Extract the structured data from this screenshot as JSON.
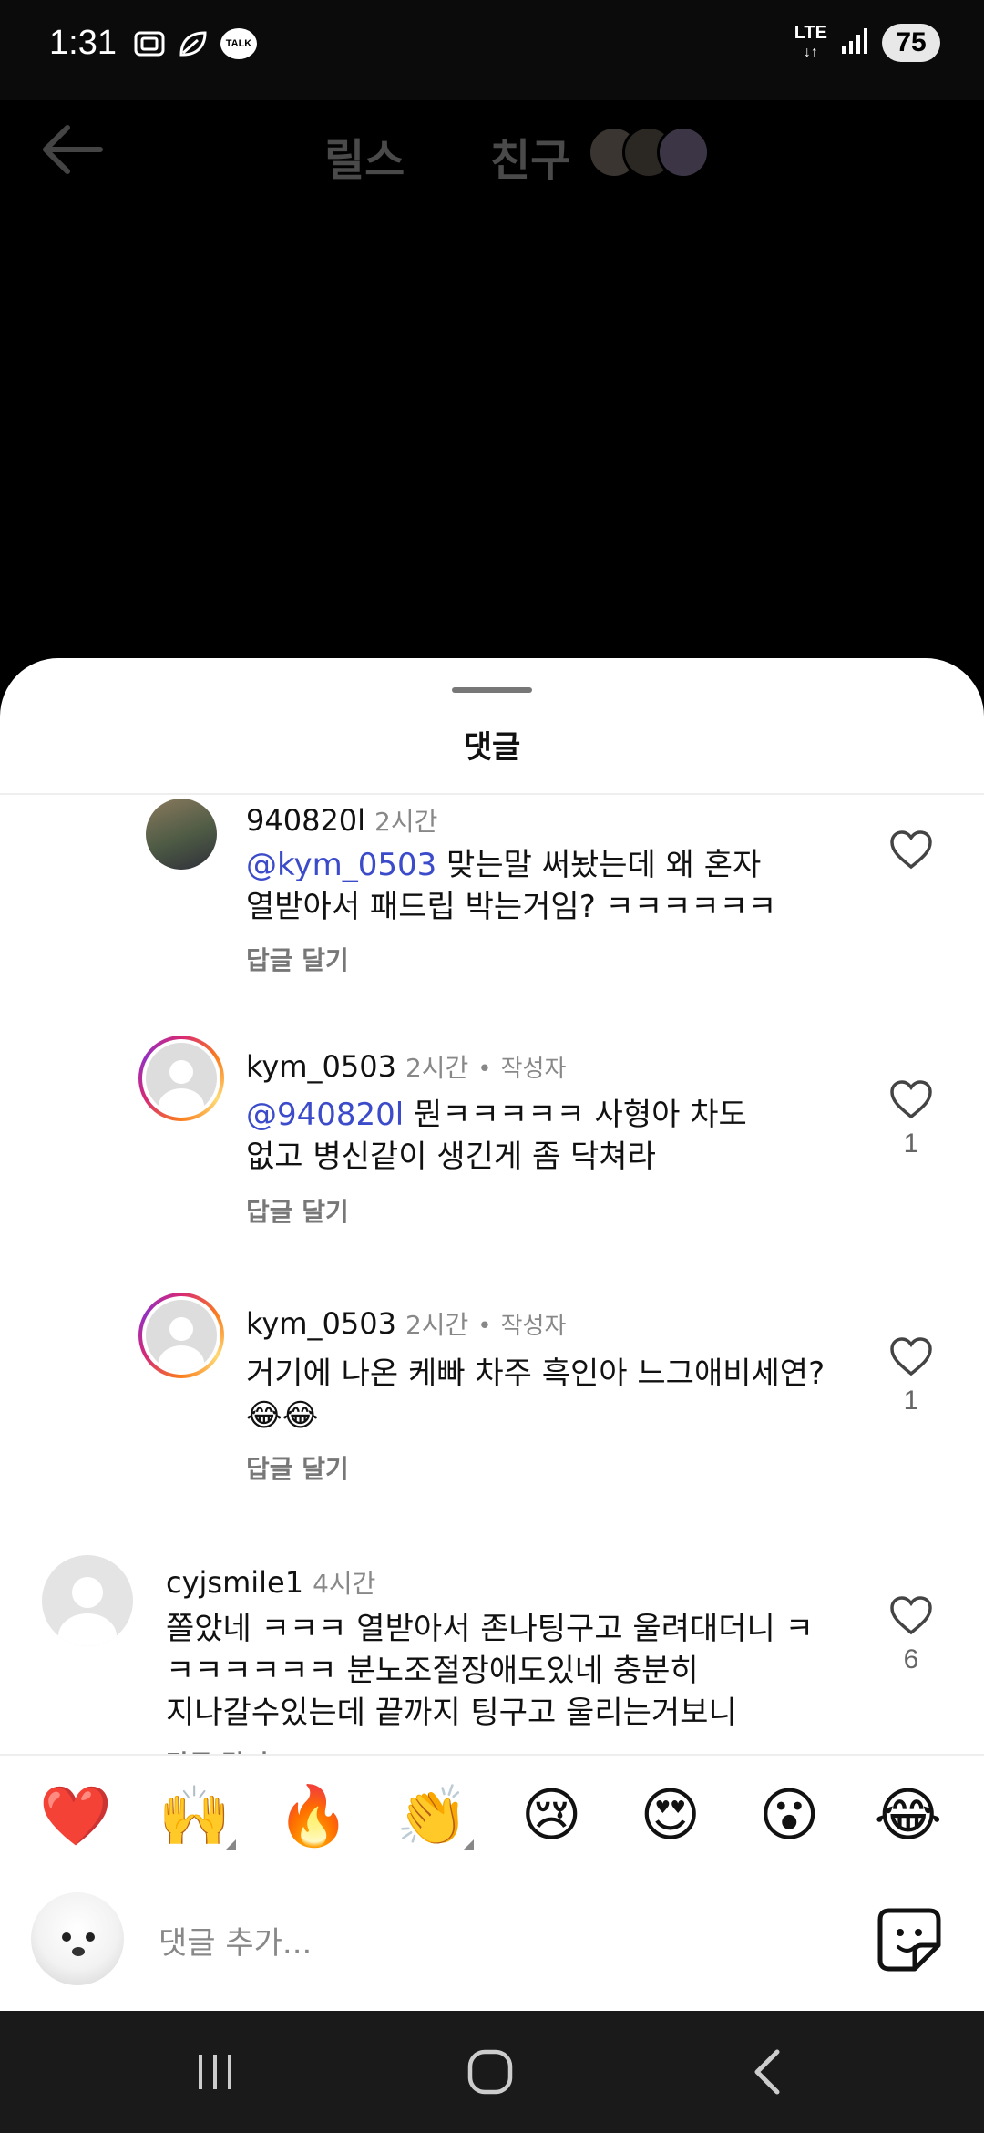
{
  "status_bar": {
    "time": "1:31",
    "talk_label": "TALK",
    "network": "LTE",
    "battery": "75"
  },
  "top_nav": {
    "tab_reels": "릴스",
    "tab_friends": "친구"
  },
  "sheet": {
    "title": "댓글"
  },
  "comments": [
    {
      "username": "940820l",
      "time": "2시간",
      "mention": "@kym_0503",
      "text_line1": " 맞는말 써놨는데 왜 혼자",
      "text_line2": "열받아서 패드립 박는거임? ㅋㅋㅋㅋㅋㅋ",
      "reply": "답글 달기",
      "likes": ""
    },
    {
      "username": "kym_0503",
      "time": "2시간",
      "separator": "•",
      "author_tag": "작성자",
      "mention": "@940820l",
      "text_line1": " 뭔ㅋㅋㅋㅋㅋ 사형아 차도",
      "text_line2": "없고 병신같이 생긴게 좀 닥쳐라",
      "reply": "답글 달기",
      "likes": "1"
    },
    {
      "username": "kym_0503",
      "time": "2시간",
      "separator": "•",
      "author_tag": "작성자",
      "text_line1": "거기에 나온 케빠 차주 흑인아 느그애비세연?",
      "text_line2": "😂😂",
      "reply": "답글 달기",
      "likes": "1"
    },
    {
      "username": "cyjsmile1",
      "time": "4시간",
      "text_line1": "쫄았네 ㅋㅋㅋ 열받아서 존나팅구고 울려대더니 ㅋ",
      "text_line2": "ㅋㅋㅋㅋㅋㅋ 분노조절장애도있네 충분히",
      "text_line3": "지나갈수있는데 끝까지 팅구고 울리는거보니",
      "reply": "답글 달기",
      "likes": "6"
    }
  ],
  "emoji_bar": [
    "❤️",
    "🙌",
    "🔥",
    "👏",
    "😢",
    "😍",
    "😮",
    "😂"
  ],
  "input": {
    "placeholder": "댓글 추가..."
  },
  "icons": {
    "back": "arrow-left-icon",
    "like": "heart-outline-icon",
    "sticker": "sticker-icon"
  },
  "colors": {
    "mention": "#3b4bc9",
    "ring_gradient": [
      "#d62976",
      "#fa7e1e",
      "#feda75",
      "#962fbf"
    ]
  }
}
